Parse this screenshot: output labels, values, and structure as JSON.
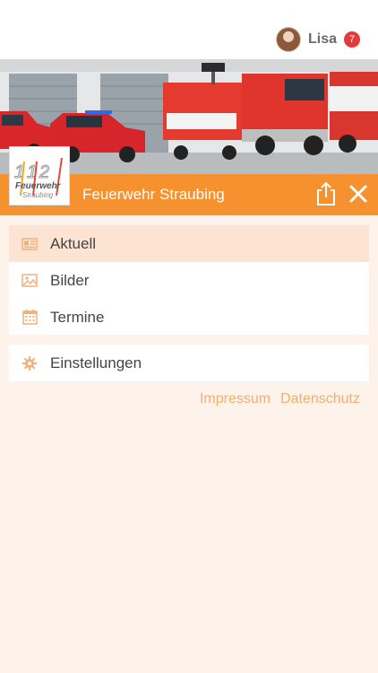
{
  "header": {
    "user_name": "Lisa",
    "notification_count": "7",
    "icons": [
      "avatar",
      "notification-badge"
    ]
  },
  "banner": {
    "org_name": "Feuerwehr Straubing",
    "logo": {
      "number": "112",
      "text": "Feuerwehr Straubing"
    },
    "icons": [
      "share-icon",
      "close-icon"
    ]
  },
  "menu": {
    "items": [
      {
        "label": "Aktuell",
        "icon": "newspaper-icon",
        "active": true
      },
      {
        "label": "Bilder",
        "icon": "image-icon",
        "active": false
      },
      {
        "label": "Termine",
        "icon": "calendar-icon",
        "active": false
      }
    ],
    "settings": {
      "label": "Einstellungen",
      "icon": "gear-icon"
    }
  },
  "footer": {
    "impressum": "Impressum",
    "datenschutz": "Datenschutz"
  },
  "colors": {
    "accent": "#f5922f",
    "active_bg": "#fde4d2",
    "page_bg": "#fdf3ea",
    "link": "#f3ae6e",
    "badge": "#e23b3b"
  }
}
